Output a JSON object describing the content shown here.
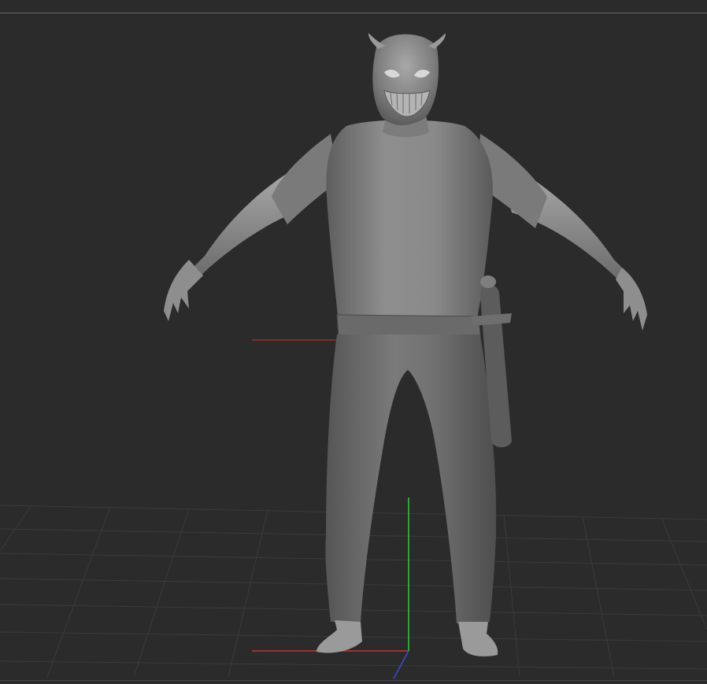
{
  "viewport": {
    "background": "#2b2b2b",
    "grid_color": "#3a3a3a",
    "axis_colors": {
      "x": "#c0392b",
      "y": "#2ecc40",
      "z": "#3b4bd6"
    }
  },
  "model": {
    "material_color": "#8a8a8a",
    "description_icon": "sculpted-character-mesh"
  }
}
